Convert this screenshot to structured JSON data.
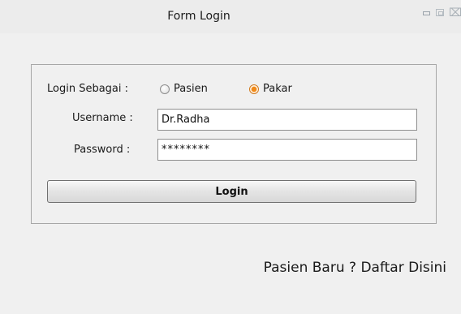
{
  "window": {
    "title": "Form Login",
    "controls": {
      "minimize": "minimize-icon",
      "maximize": "maximize-icon",
      "close": "close-icon"
    }
  },
  "form": {
    "login_as_label": "Login Sebagai :",
    "roles": [
      {
        "label": "Pasien",
        "checked": false
      },
      {
        "label": "Pakar",
        "checked": true
      }
    ],
    "username_label": "Username :",
    "username_value": "Dr.Radha",
    "password_label": "Password :",
    "password_value": "********",
    "login_button": "Login"
  },
  "footer": {
    "signup_link": "Pasien Baru ? Daftar Disini"
  },
  "colors": {
    "radio_selected": "#f08a19",
    "window_background": "#f0f0f0"
  }
}
